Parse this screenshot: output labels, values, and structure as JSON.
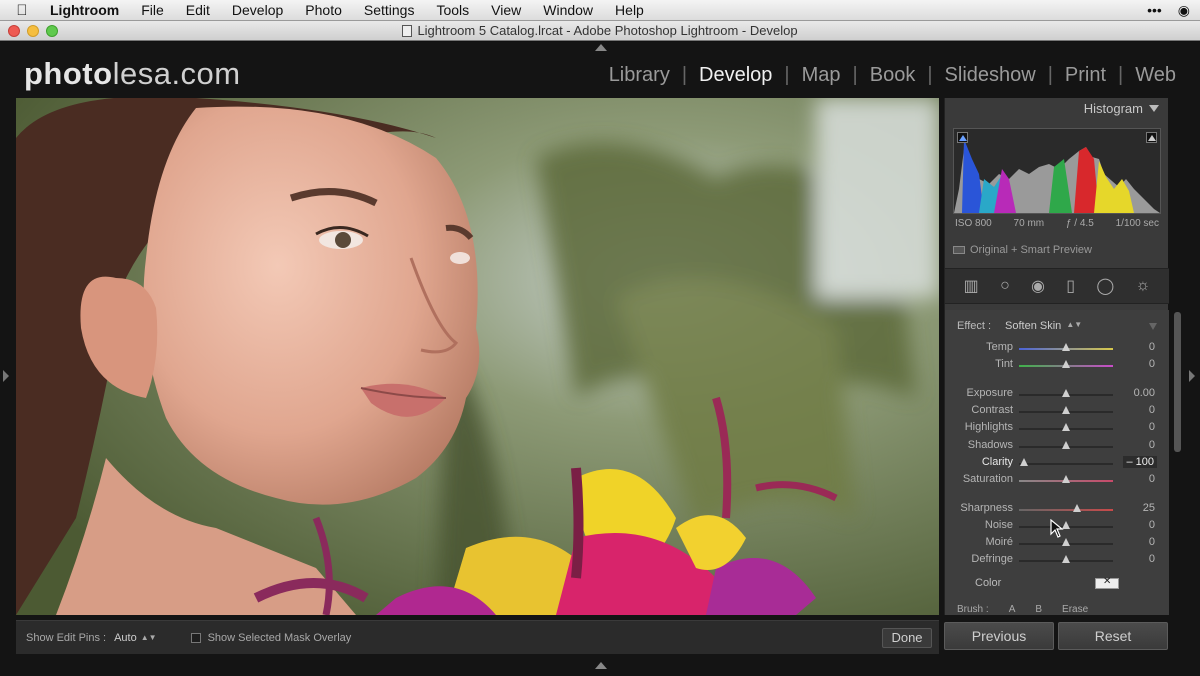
{
  "menubar": {
    "app": "Lightroom",
    "items": [
      "File",
      "Edit",
      "Develop",
      "Photo",
      "Settings",
      "Tools",
      "View",
      "Window",
      "Help"
    ]
  },
  "window": {
    "title": "Lightroom 5 Catalog.lrcat - Adobe Photoshop Lightroom - Develop"
  },
  "logo": {
    "bold": "photo",
    "rest": "lesa.com"
  },
  "modules": [
    "Library",
    "Develop",
    "Map",
    "Book",
    "Slideshow",
    "Print",
    "Web"
  ],
  "active_module": "Develop",
  "histogram": {
    "title": "Histogram",
    "iso": "ISO 800",
    "focal": "70 mm",
    "aperture": "ƒ / 4.5",
    "shutter": "1/100 sec",
    "preview_label": "Original + Smart Preview"
  },
  "adjustment": {
    "effect_label": "Effect :",
    "effect_value": "Soften Skin",
    "sliders": [
      {
        "label": "Temp",
        "value": "0",
        "pos": 0.5
      },
      {
        "label": "Tint",
        "value": "0",
        "pos": 0.5
      },
      {
        "label": "Exposure",
        "value": "0.00",
        "pos": 0.5
      },
      {
        "label": "Contrast",
        "value": "0",
        "pos": 0.5
      },
      {
        "label": "Highlights",
        "value": "0",
        "pos": 0.5
      },
      {
        "label": "Shadows",
        "value": "0",
        "pos": 0.5
      },
      {
        "label": "Clarity",
        "value": "– 100",
        "pos": 0.05
      },
      {
        "label": "Saturation",
        "value": "0",
        "pos": 0.5
      },
      {
        "label": "Sharpness",
        "value": "25",
        "pos": 0.62
      },
      {
        "label": "Noise",
        "value": "0",
        "pos": 0.5
      },
      {
        "label": "Moiré",
        "value": "0",
        "pos": 0.5
      },
      {
        "label": "Defringe",
        "value": "0",
        "pos": 0.5
      }
    ],
    "color_label": "Color",
    "brush_label": "Brush :",
    "brush_a": "A",
    "brush_b": "B",
    "brush_erase": "Erase"
  },
  "toolbar": {
    "pins_label": "Show Edit Pins :",
    "pins_value": "Auto",
    "mask_label": "Show Selected Mask Overlay",
    "done": "Done"
  },
  "buttons": {
    "previous": "Previous",
    "reset": "Reset"
  }
}
